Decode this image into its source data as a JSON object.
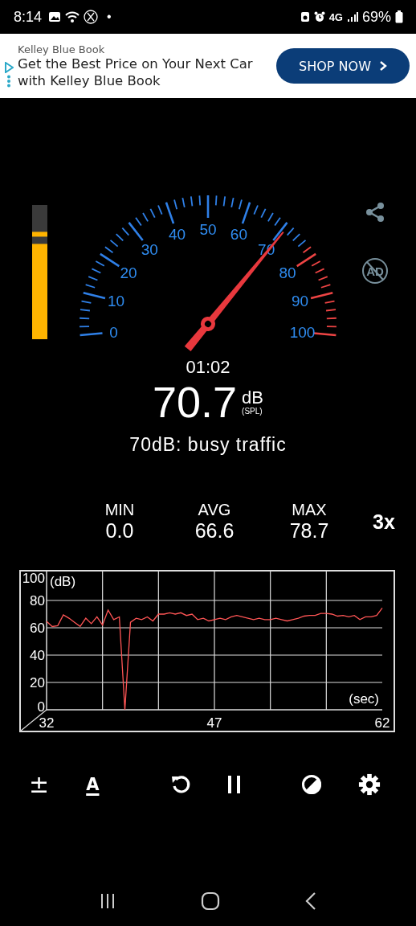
{
  "status_bar": {
    "time": "8:14",
    "dot": "•",
    "network": "4G",
    "battery": "69%"
  },
  "ad": {
    "source": "Kelley Blue Book",
    "headline": "Get the Best Price on Your Next Car with Kelley Blue Book",
    "button": "SHOP NOW"
  },
  "meter": {
    "level": 0.71
  },
  "gauge": {
    "labels": [
      "0",
      "10",
      "20",
      "30",
      "40",
      "50",
      "60",
      "70",
      "80",
      "90",
      "100"
    ]
  },
  "no_ads_badge": "AD",
  "elapsed": "01:02",
  "reading": {
    "value": "70.7",
    "unit": "dB",
    "weighting": "(SPL)"
  },
  "description": "70dB: busy traffic",
  "stats": [
    {
      "label": "MIN",
      "value": "0.0"
    },
    {
      "label": "AVG",
      "value": "66.6"
    },
    {
      "label": "MAX",
      "value": "78.7"
    }
  ],
  "zoom_button": "3x",
  "chart_data": {
    "type": "line",
    "grid": true,
    "xlabel": "(sec)",
    "ylabel": "(dB)",
    "xlim": [
      32,
      62
    ],
    "ylim": [
      0,
      100
    ],
    "xticks": [
      32,
      47,
      62
    ],
    "yticks": [
      0,
      20,
      40,
      60,
      80,
      100
    ],
    "x": [
      32,
      32.5,
      33,
      33.5,
      34,
      34.5,
      35,
      35.5,
      36,
      36.5,
      37,
      37.5,
      38,
      38.5,
      39,
      39.5,
      40,
      40.5,
      41,
      41.5,
      42,
      42.5,
      43,
      43.5,
      44,
      44.5,
      45,
      45.5,
      46,
      46.5,
      47,
      47.5,
      48,
      48.5,
      49,
      49.5,
      50,
      50.5,
      51,
      51.5,
      52,
      52.5,
      53,
      53.5,
      54,
      54.5,
      55,
      55.5,
      56,
      56.5,
      57,
      57.5,
      58,
      58.5,
      59,
      59.5,
      60,
      60.5,
      61,
      61.5,
      62
    ],
    "series": [
      {
        "color": "#ff5555",
        "values": [
          64.7,
          60.9,
          61.6,
          69.5,
          67,
          64,
          61,
          67,
          63,
          68,
          62,
          73,
          66,
          68,
          0,
          64,
          67,
          66,
          68,
          65,
          70,
          70,
          71,
          70,
          71,
          69,
          70,
          66,
          67,
          65,
          66,
          67,
          66,
          68,
          69,
          68,
          67,
          66,
          67,
          66,
          66,
          67,
          66,
          65,
          66,
          67,
          68.5,
          69,
          69,
          70.5,
          70.5,
          70,
          68.5,
          69,
          68,
          69,
          66,
          68,
          68,
          69,
          74.5
        ]
      }
    ]
  },
  "toolbar": [
    {
      "kind": "glyph",
      "text": "±",
      "underlined": false
    },
    {
      "kind": "glyph",
      "text": "A",
      "underlined": true
    },
    {
      "kind": "reset"
    },
    {
      "kind": "pause"
    },
    {
      "kind": "contrast"
    },
    {
      "kind": "settings"
    }
  ],
  "nav_bar": [
    {
      "kind": "recents"
    },
    {
      "kind": "home"
    },
    {
      "kind": "back"
    }
  ]
}
